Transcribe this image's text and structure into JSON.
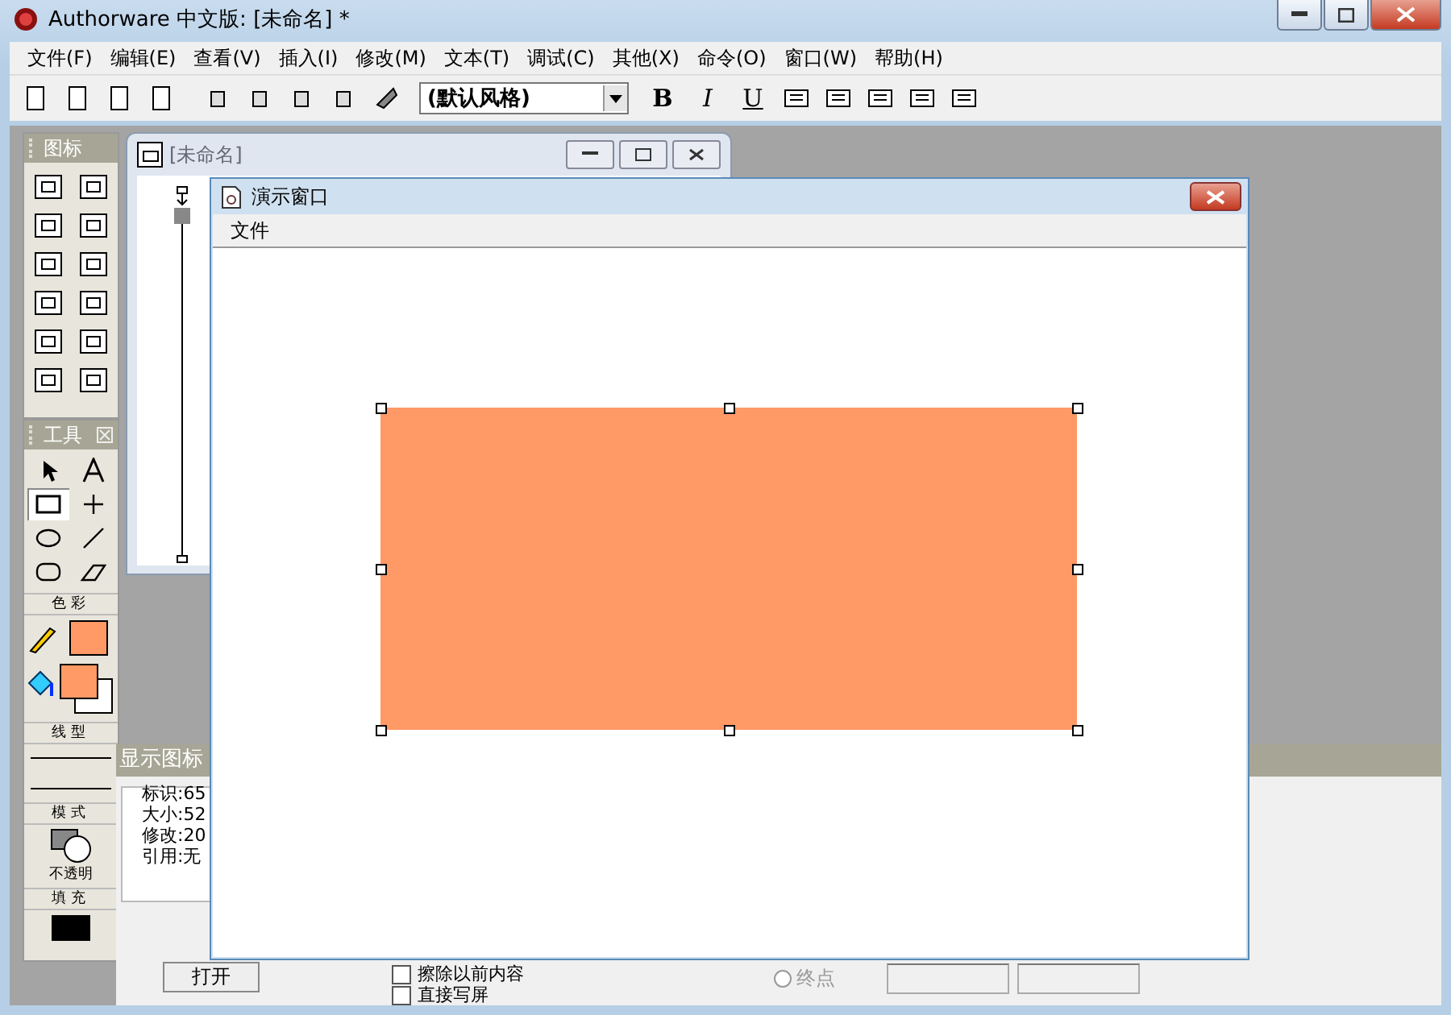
{
  "window": {
    "title": "Authorware 中文版: [未命名] *"
  },
  "menu": [
    "文件(F)",
    "编辑(E)",
    "查看(V)",
    "插入(I)",
    "修改(M)",
    "文本(T)",
    "调试(C)",
    "其他(X)",
    "命令(O)",
    "窗口(W)",
    "帮助(H)"
  ],
  "toolbar": {
    "style_dropdown": "(默认风格)",
    "format_buttons": [
      "B",
      "I",
      "U"
    ]
  },
  "icon_palette": {
    "title": "图标"
  },
  "tools_palette": {
    "title": "工具",
    "tools": [
      {
        "kind": "pointer",
        "selected": false
      },
      {
        "kind": "text",
        "selected": false
      },
      {
        "kind": "rectangle",
        "selected": true
      },
      {
        "kind": "line",
        "selected": false
      },
      {
        "kind": "ellipse",
        "selected": false
      },
      {
        "kind": "diagonal",
        "selected": false
      },
      {
        "kind": "rounded",
        "selected": false
      },
      {
        "kind": "polygon",
        "selected": false
      }
    ],
    "color_label": "色彩",
    "line_label": "线型",
    "mode_label": "模式",
    "mode_value": "不透明",
    "fill_label": "填充"
  },
  "flow_window": {
    "title": "[未命名]"
  },
  "presentation_window": {
    "title": "演示窗口",
    "menu": [
      "文件"
    ]
  },
  "properties": {
    "header": "显示图标",
    "info": [
      "标识:65",
      "大小:52",
      "修改:20",
      "引用:无"
    ],
    "open_button": "打开",
    "checkboxes": [
      {
        "label": "擦除以前内容",
        "checked": false
      },
      {
        "label": "直接写屏",
        "checked": false
      }
    ],
    "radio": {
      "label": "终点",
      "selected": false
    }
  }
}
